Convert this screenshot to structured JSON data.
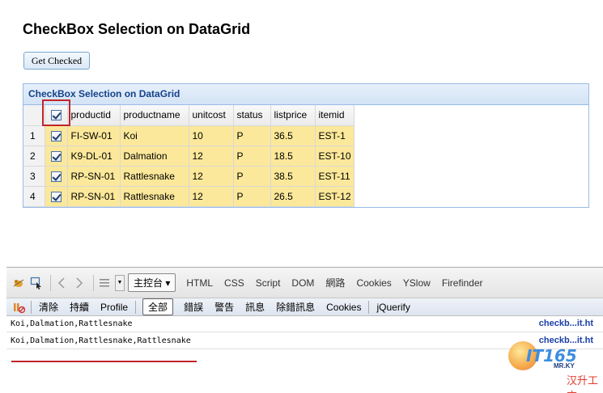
{
  "page": {
    "title": "CheckBox Selection on DataGrid"
  },
  "button": {
    "label": "Get Checked"
  },
  "grid": {
    "title": "CheckBox Selection on DataGrid",
    "columns": [
      "productid",
      "productname",
      "unitcost",
      "status",
      "listprice",
      "itemid"
    ],
    "rows": [
      {
        "num": "1",
        "productid": "FI-SW-01",
        "productname": "Koi",
        "unitcost": "10",
        "status": "P",
        "listprice": "36.5",
        "itemid": "EST-1"
      },
      {
        "num": "2",
        "productid": "K9-DL-01",
        "productname": "Dalmation",
        "unitcost": "12",
        "status": "P",
        "listprice": "18.5",
        "itemid": "EST-10"
      },
      {
        "num": "3",
        "productid": "RP-SN-01",
        "productname": "Rattlesnake",
        "unitcost": "12",
        "status": "P",
        "listprice": "38.5",
        "itemid": "EST-11"
      },
      {
        "num": "4",
        "productid": "RP-SN-01",
        "productname": "Rattlesnake",
        "unitcost": "12",
        "status": "P",
        "listprice": "26.5",
        "itemid": "EST-12"
      }
    ],
    "selected_row_color": "#fbe89a"
  },
  "firebug": {
    "console_tab": "主控台",
    "tabs": [
      "HTML",
      "CSS",
      "Script",
      "DOM",
      "網路",
      "Cookies",
      "YSlow",
      "Firefinder"
    ],
    "subtoolbar": {
      "clear": "清除",
      "persist": "持續",
      "profile": "Profile",
      "all": "全部",
      "errors": "錯誤",
      "warnings": "警告",
      "info": "訊息",
      "debug": "除錯訊息",
      "cookies": "Cookies",
      "jquerify": "jQuerify"
    },
    "logs": [
      {
        "text": "Koi,Dalmation,Rattlesnake",
        "source": "checkb...it.ht"
      },
      {
        "text": "Koi,Dalmation,Rattlesnake,Rattlesnake",
        "source": "checkb...it.ht"
      }
    ]
  },
  "watermark": {
    "brand": "IT165",
    "sub": "MR.KY",
    "cn": "汉升工方"
  },
  "colors": {
    "accent": "#15428b",
    "annotation": "#c0262c"
  }
}
